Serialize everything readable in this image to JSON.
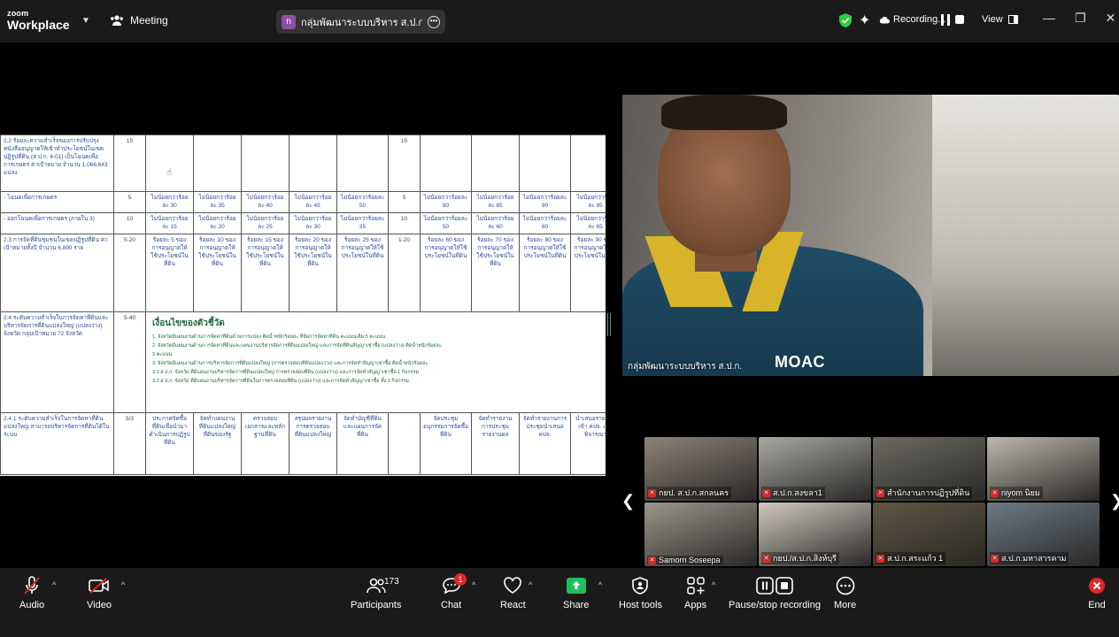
{
  "app": {
    "logo_small": "zoom",
    "logo_big": "Workplace",
    "meeting_label": "Meeting"
  },
  "share": {
    "badge": "n",
    "title": "กลุ่มพัฒนาระบบบริหาร ส.ป.ก.'s screen"
  },
  "status": {
    "recording_label": "Recording...",
    "view_label": "View"
  },
  "document": {
    "rows": [
      {
        "desc": "2.2 ร้อยละความสำเร็จของการปรับปรุงหนังสืออนุญาตให้เข้าทำประโยชน์ในเขตปฏิรูปที่ดิน (ส.ป.ก. 4-01) เป็นโฉนดเพื่อการเกษตร ค่าเป้าหมาย จำนวน 1,066,643 แปลง",
        "weight": "15",
        "cells": [
          "",
          "",
          "",
          "",
          "",
          "15",
          "",
          "",
          "",
          ""
        ]
      },
      {
        "desc": "- โฉนดเพื่อการเกษตร",
        "weight": "5",
        "cells": [
          "ไม่น้อยกว่าร้อยละ 30",
          "ไม่น้อยกว่าร้อยละ 35",
          "ไม่น้อยกว่าร้อยละ 40",
          "ไม่น้อยกว่าร้อยละ 45",
          "ไม่น้อยกว่าร้อยละ 50",
          "5",
          "ไม่น้อยกว่าร้อยละ 80",
          "ไม่น้อยกว่าร้อยละ 85",
          "ไม่น้อยกว่าร้อยละ 90",
          "ไม่น้อยกว่าร้อยละ 95"
        ]
      },
      {
        "desc": "- ออกโฉนดเพื่อการเกษตร (ภายใน 3)",
        "weight": "10",
        "cells": [
          "ไม่น้อยกว่าร้อยละ 15",
          "ไม่น้อยกว่าร้อยละ 20",
          "ไม่น้อยกว่าร้อยละ 25",
          "ไม่น้อยกว่าร้อยละ 30",
          "ไม่น้อยกว่าร้อยละ 35",
          "10",
          "ไม่น้อยกว่าร้อยละ 50",
          "ไม่น้อยกว่าร้อยละ 60",
          "ไม่น้อยกว่าร้อยละ 60",
          "ไม่น้อยกว่าร้อยละ 65"
        ]
      },
      {
        "desc": "2.3 การจัดที่ดินชุมชนในเขตปฏิรูปที่ดิน ค่าเป้าหมายทั้งปี จำนวน 6,890 ราย",
        "weight": "5-20",
        "cells": [
          "ร้อยละ 5 ของการอนุญาตให้ใช้ประโยชน์ในที่ดิน",
          "ร้อยละ 10 ของการอนุญาตให้ใช้ประโยชน์ในที่ดิน",
          "ร้อยละ 15 ของการอนุญาตให้ใช้ประโยชน์ในที่ดิน",
          "ร้อยละ 20 ของการอนุญาตให้ใช้ประโยชน์ในที่ดิน",
          "ร้อยละ 25 ของการอนุญาตให้ใช้ประโยชน์ในที่ดิน",
          "1-20",
          "ร้อยละ 60 ของการอนุญาตให้ใช้ประโยชน์ในที่ดิน",
          "ร้อยละ 70 ของการอนุญาตให้ใช้ประโยชน์ในที่ดิน",
          "ร้อยละ 80 ของการอนุญาตให้ใช้ประโยชน์ในที่ดิน",
          "ร้อยละ 90 ของการอนุญาตให้ใช้ประโยชน์ในที่ดิน"
        ]
      },
      {
        "desc": "2.4 ระดับความสำเร็จในการจัดหาที่ดินและบริหารจัดการที่ดินแปลงใหญ่ (แปลงว่าง) จังหวัด กลุ่มเป้าหมาย 72 จังหวัด",
        "weight": "5-40",
        "merged_title": "เงื่อนไขของตัวชี้วัด",
        "merged_lines": [
          "1. จังหวัดมีแผนงานด้านการจัดหาที่ดินด้านการแปลง ติดน้ำหนักร้อยละ ที่จัดการจัดหาที่ดิน คะแนนเต็ม 5 คะแนน",
          "2. จังหวัดมีแผนงานด้านการจัดหาที่ดินและแผนงานบริหารจัดการที่ดินแปลงใหญ่ และการจัดที่ดินสัญญาเช่าซื้อ (แปลงว่าง) ติดน้ำหนักร้อยละ",
          "   3 คะแนน",
          "3. จังหวัดมีแผนงานด้านการบริหารจัดการที่ดินแปลงใหญ่ (การตรวจสอบที่ดินแปลงว่าง) และการจัดทำสัญญาเช่าซื้อ ติดน้ำหนักร้อยละ",
          "3.1 ส.ป.ก. จังหวัด ที่มีแผนงานบริหารจัดการที่ดินแปลงใหญ่ การตรวจสอบที่ดิน (แปลงว่าง) และการจัดทำสัญญาเช่าซื้อ 1 กิจกรรม",
          "3.2 ส.ป.ก. จังหวัด ที่มีแผนงานบริหารจัดการที่ดินในการตรวจสอบที่ดิน (แปลงว่าง) และการจัดทำสัญญาเช่าซื้อ ทั้ง 2 กิจกรรม"
        ]
      },
      {
        "desc": "2.4.1 ระดับความสำเร็จในการจัดหาที่ดินแปลงใหญ่ สามารถบริหารจัดการที่ดินได้ในระบบ",
        "weight": "5/3",
        "cells": [
          "ประกาศจัดซื้อที่ดินเพื่อนำมาดำเนินการปฏิรูปที่ดิน",
          "จัดทำแผนงานที่ดินแปลงใหญ่ที่ดินของรัฐ",
          "ตรวจสอบเอกสารและหลักฐานที่ดิน",
          "สรุปผลรายงานการตรวจสอบที่ดินแปลงใหญ่",
          "จัดทำบัญชีที่ดินและแผนการจัดที่ดิน",
          "",
          "จัดประชุมอนุกรรมการจัดซื้อที่ดิน",
          "จัดทำรายงานการประชุมรายงานผล",
          "จัดทำรายงานการประชุมนำเสนอ คปจ.",
          "นำเสนอรายงานเข้า คปจ. เพื่อพิจารณา"
        ]
      }
    ]
  },
  "speaker": {
    "name": "กลุ่มพัฒนาระบบบริหาร ส.ป.ก.",
    "logo_text": "MOAC"
  },
  "gallery": [
    {
      "name": "กยป. ส.ป.ก.สกลนคร",
      "bg": "#8d8479"
    },
    {
      "name": "ส.ป.ก.สงขลา1",
      "bg": "#a9a7a2"
    },
    {
      "name": "สำนักงานการปฏิรูปที่ดิน",
      "bg": "#6c6a62"
    },
    {
      "name": "niyom นิยม",
      "bg": "#bdb8ae"
    },
    {
      "name": "Samorn Soseepa",
      "bg": "#9a968c"
    },
    {
      "name": "กยป./ส.ป.ก.สิงห์บุรี",
      "bg": "#cfc9c0"
    },
    {
      "name": "ส.ป.ก.สระแก้ว 1",
      "bg": "#5e5742"
    },
    {
      "name": "ส.ป.ก.มหาสารคาม",
      "bg": "#6b7a86"
    }
  ],
  "toolbar": {
    "audio": "Audio",
    "video": "Video",
    "participants": "Participants",
    "participants_count": "173",
    "chat": "Chat",
    "chat_badge": "1",
    "react": "React",
    "share": "Share",
    "host_tools": "Host tools",
    "apps": "Apps",
    "pause_stop": "Pause/stop recording",
    "more": "More",
    "end": "End"
  },
  "colors": {
    "share_green": "#1fbf5a",
    "end_red": "#e02828",
    "shield_green": "#2ecc40"
  }
}
